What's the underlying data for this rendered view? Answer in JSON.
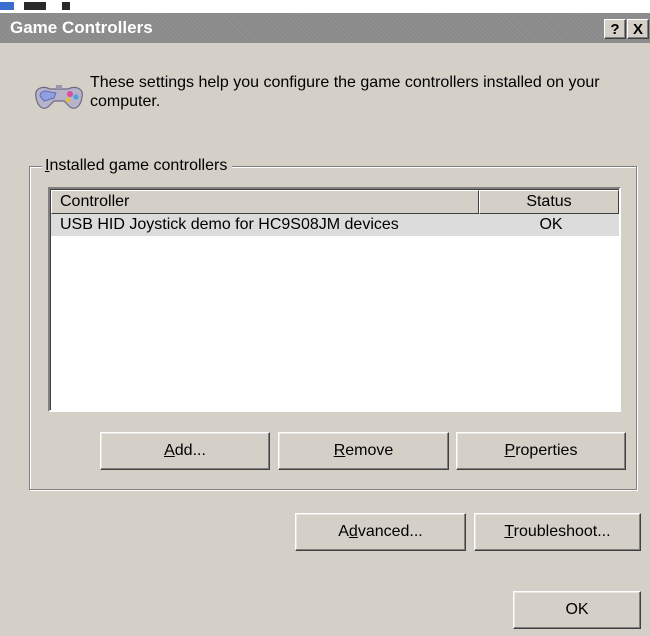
{
  "window": {
    "title": "Game Controllers",
    "help_label": "?",
    "close_label": "X"
  },
  "intro": {
    "text": "These settings help you configure the game controllers installed on your computer."
  },
  "group": {
    "label_first": "I",
    "label_rest": "nstalled game controllers"
  },
  "list": {
    "headers": {
      "controller": "Controller",
      "status": "Status"
    },
    "rows": [
      {
        "controller": "USB HID Joystick demo for HC9S08JM devices",
        "status": "OK"
      }
    ]
  },
  "buttons": {
    "add": {
      "u": "A",
      "rest": "dd..."
    },
    "remove": {
      "u": "R",
      "rest": "emove"
    },
    "properties": {
      "u": "P",
      "rest": "roperties"
    },
    "advanced": {
      "pre": "A",
      "u": "d",
      "rest": "vanced..."
    },
    "troubleshoot": {
      "u": "T",
      "rest": "roubleshoot..."
    },
    "ok": "OK"
  },
  "colors": {
    "dialog_bg": "#d4d0c8",
    "titlebar_inactive": "#8a8a8a",
    "selected_row": "#dcdcdc"
  }
}
